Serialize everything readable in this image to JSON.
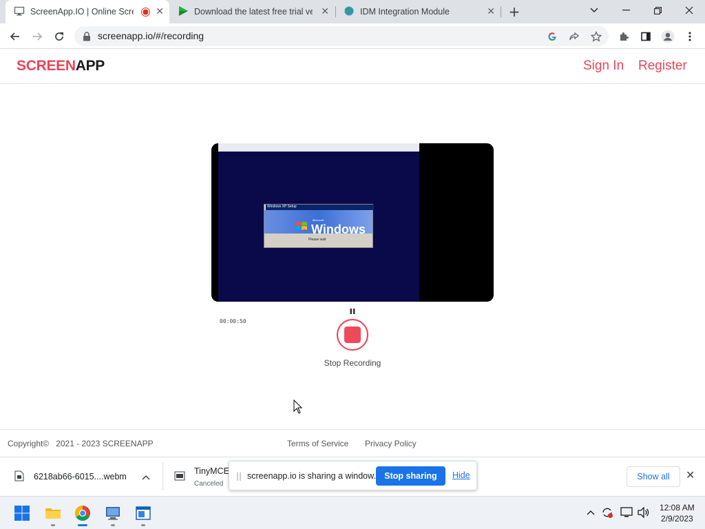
{
  "browser": {
    "tabs": [
      {
        "title": "ScreenApp.IO | Online Scree",
        "favicon": "monitor-icon",
        "active": true,
        "recording": true
      },
      {
        "title": "Download the latest free trial ver",
        "favicon": "play-icon",
        "active": false
      },
      {
        "title": "IDM Integration Module",
        "favicon": "globe-icon",
        "active": false
      }
    ],
    "new_tab": "+",
    "url": "screenapp.io/#/recording"
  },
  "site": {
    "logo_part1": "SCREEN",
    "logo_part2": "APP",
    "sign_in": "Sign In",
    "register": "Register",
    "brand_color": "#e8455a"
  },
  "recorder": {
    "preview": {
      "dialog_title": "Windows XP Setup",
      "banner_text": "Windows",
      "banner_small": "Microsoft",
      "wait_text": "Please wait"
    },
    "timer": "00:00:50",
    "stop_label": "Stop Recording"
  },
  "footer": {
    "copyright": "Copyright©   2021 - 2023 SCREENAPP",
    "terms": "Terms of Service",
    "privacy": "Privacy Policy"
  },
  "downloads": {
    "items": [
      {
        "name": "6218ab66-6015....webm",
        "status": ""
      },
      {
        "name": "TinyMCE",
        "status": "Canceled"
      }
    ],
    "show_all": "Show all"
  },
  "share_bar": {
    "message": "screenapp.io is sharing a window.",
    "stop_button": "Stop sharing",
    "hide_link": "Hide"
  },
  "taskbar": {
    "time": "12:08 AM",
    "date": "2/9/2023"
  }
}
